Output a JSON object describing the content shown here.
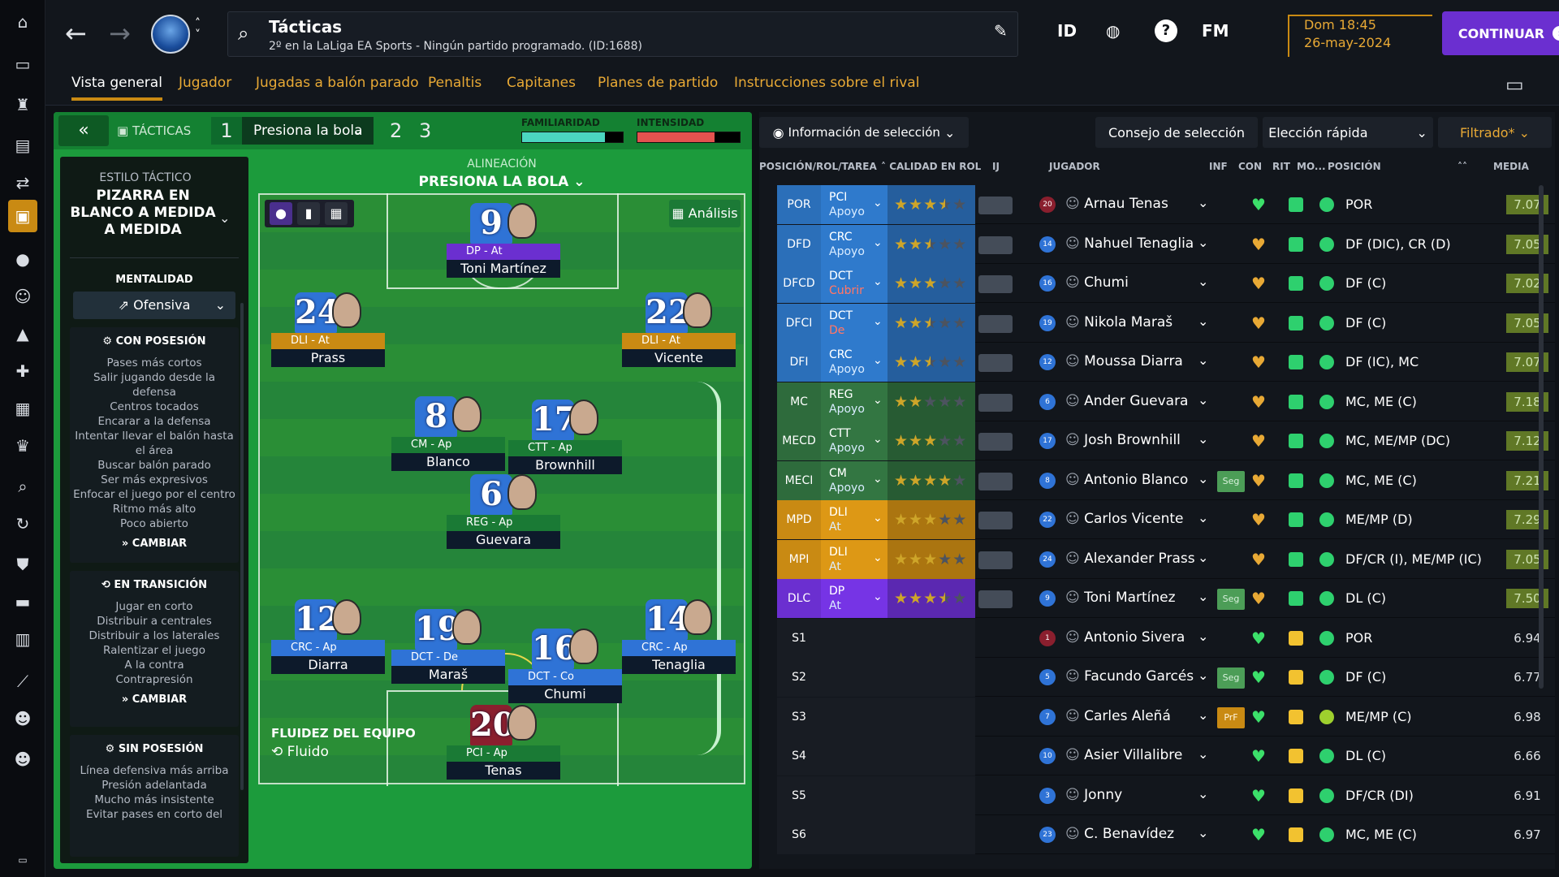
{
  "app": {
    "title": "Tácticas",
    "subtitle": "2º en la LaLiga EA Sports - Ningún partido programado. (ID:1688)"
  },
  "topbar": {
    "id_label": "ID",
    "help": "?",
    "fm": "FM",
    "date_line1": "Dom 18:45",
    "date_line2": "26-may-2024",
    "continue_label": "CONTINUAR"
  },
  "tabs": [
    "Vista general",
    "Jugador",
    "Jugadas a balón parado",
    "Penaltis",
    "Capitanes",
    "Planes de partido",
    "Instrucciones sobre el rival"
  ],
  "tactic_bar": {
    "label": "TÁCTICAS",
    "slot1": "1",
    "tactic_name": "Presiona la bola",
    "slot2": "2",
    "slot3": "3",
    "familiarity_label": "FAMILIARIDAD",
    "familiarity_value": 0.82,
    "intensity_label": "INTENSIDAD",
    "intensity_value": 0.75
  },
  "style": {
    "heading": "ESTILO TÁCTICO",
    "name": "PIZARRA EN BLANCO A MEDIDA A MEDIDA",
    "mentality_label": "MENTALIDAD",
    "mentality_value": "Ofensiva",
    "in_possession": {
      "title": "CON POSESIÓN",
      "items": [
        "Pases más cortos",
        "Salir jugando desde la defensa",
        "Centros tocados",
        "Encarar a la defensa",
        "Intentar llevar el balón hasta el área",
        "Buscar balón parado",
        "Ser más expresivos",
        "Enfocar el juego por el centro",
        "Ritmo más alto",
        "Poco abierto"
      ],
      "change": "CAMBIAR"
    },
    "transition": {
      "title": "EN TRANSICIÓN",
      "items": [
        "Jugar en corto",
        "Distribuir a centrales",
        "Distribuir a los laterales",
        "Ralentizar el juego",
        "A la contra",
        "Contrapresión"
      ],
      "change": "CAMBIAR"
    },
    "out_possession": {
      "title": "SIN POSESIÓN",
      "items": [
        "Línea defensiva más arriba",
        "Presión adelantada",
        "Mucho más insistente",
        "Evitar pases en corto del"
      ]
    }
  },
  "pitch": {
    "alignment_label": "ALINEACIÓN",
    "alignment_name": "PRESIONA LA BOLA",
    "analysis_label": "Análisis",
    "fluidity_label": "FLUIDEZ DEL EQUIPO",
    "fluidity_value": "Fluido",
    "players": [
      {
        "num": "9",
        "role": "DP - At",
        "name": "Toni Martínez",
        "kind": "st"
      },
      {
        "num": "24",
        "role": "DLI - At",
        "name": "Prass",
        "kind": "wing"
      },
      {
        "num": "22",
        "role": "DLI - At",
        "name": "Vicente",
        "kind": "wing"
      },
      {
        "num": "8",
        "role": "CM - Ap",
        "name": "Blanco",
        "kind": "mid"
      },
      {
        "num": "17",
        "role": "CTT - Ap",
        "name": "Brownhill",
        "kind": "mid"
      },
      {
        "num": "6",
        "role": "REG - Ap",
        "name": "Guevara",
        "kind": "mid"
      },
      {
        "num": "12",
        "role": "CRC - Ap",
        "name": "Diarra",
        "kind": "def"
      },
      {
        "num": "19",
        "role": "DCT - De",
        "name": "Maraš",
        "kind": "def"
      },
      {
        "num": "16",
        "role": "DCT - Co",
        "name": "Chumi",
        "kind": "def"
      },
      {
        "num": "14",
        "role": "CRC - Ap",
        "name": "Tenaglia",
        "kind": "def"
      },
      {
        "num": "20",
        "role": "PCI - Ap",
        "name": "Tenas",
        "kind": "gk"
      }
    ]
  },
  "selection": {
    "info_btn": "Información de selección",
    "advice_btn": "Consejo de selección",
    "quick_btn": "Elección rápida",
    "filter_btn": "Filtrado*",
    "columns": [
      "POSICIÓN/ROL/TAREA",
      "CALIDAD EN ROL",
      "IJ",
      "JUGADOR",
      "INF",
      "CON",
      "RIT",
      "MO...",
      "POSICIÓN",
      "MEDIA"
    ],
    "rows": [
      {
        "pos": "POR",
        "role": "PCI",
        "duty": "Apoyo",
        "stars": 3.5,
        "avatar": "20",
        "name": "Arnau Tenas",
        "inf": "",
        "con": "#3ce06a",
        "posn": "POR",
        "media": "7.07",
        "color": "#2b6fb9"
      },
      {
        "pos": "DFD",
        "role": "CRC",
        "duty": "Apoyo",
        "stars": 2.5,
        "avatar": "14",
        "name": "Nahuel Tenaglia",
        "inf": "",
        "con": "#e8a935",
        "posn": "DF (DIC), CR (D)",
        "media": "7.05",
        "color": "#2b6fb9"
      },
      {
        "pos": "DFCD",
        "role": "DCT",
        "duty": "Cubrir",
        "stars": 3,
        "avatar": "16",
        "name": "Chumi",
        "inf": "",
        "con": "#e8a935",
        "posn": "DF (C)",
        "media": "7.02",
        "color": "#2b6fb9"
      },
      {
        "pos": "DFCI",
        "role": "DCT",
        "duty": "De",
        "stars": 2.5,
        "avatar": "19",
        "name": "Nikola Maraš",
        "inf": "",
        "con": "#e8a935",
        "posn": "DF (C)",
        "media": "7.05",
        "color": "#2b6fb9"
      },
      {
        "pos": "DFI",
        "role": "CRC",
        "duty": "Apoyo",
        "stars": 2.5,
        "avatar": "12",
        "name": "Moussa Diarra",
        "inf": "",
        "con": "#e8a935",
        "posn": "DF (IC), MC",
        "media": "7.07",
        "color": "#2b6fb9"
      },
      {
        "pos": "MC",
        "role": "REG",
        "duty": "Apoyo",
        "stars": 2,
        "avatar": "6",
        "name": "Ander Guevara",
        "inf": "",
        "con": "#e8a935",
        "posn": "MC, ME (C)",
        "media": "7.18",
        "color": "#2e6b3c"
      },
      {
        "pos": "MECD",
        "role": "CTT",
        "duty": "Apoyo",
        "stars": 3,
        "avatar": "17",
        "name": "Josh Brownhill",
        "inf": "",
        "con": "#e8a935",
        "posn": "MC, ME/MP (DC)",
        "media": "7.12",
        "color": "#2e6b3c"
      },
      {
        "pos": "MECI",
        "role": "CM",
        "duty": "Apoyo",
        "stars": 4,
        "avatar": "8",
        "name": "Antonio Blanco",
        "inf": "Seg",
        "con": "#e8a935",
        "posn": "MC, ME (C)",
        "media": "7.21",
        "color": "#2e6b3c"
      },
      {
        "pos": "MPD",
        "role": "DLI",
        "duty": "At",
        "stars": 3,
        "avatar": "22",
        "name": "Carlos Vicente",
        "inf": "",
        "con": "#e8a935",
        "posn": "ME/MP (D)",
        "media": "7.29",
        "color": "#c98a13"
      },
      {
        "pos": "MPI",
        "role": "DLI",
        "duty": "At",
        "stars": 3,
        "avatar": "24",
        "name": "Alexander Prass",
        "inf": "",
        "con": "#e8a935",
        "posn": "DF/CR (I), ME/MP (IC)",
        "media": "7.05",
        "color": "#c98a13"
      },
      {
        "pos": "DLC",
        "role": "DP",
        "duty": "At",
        "stars": 3.5,
        "avatar": "9",
        "name": "Toni Martínez",
        "inf": "Seg",
        "con": "#e8a935",
        "posn": "DL (C)",
        "media": "7.50",
        "color": "#6b2fd0"
      },
      {
        "pos": "S1",
        "role": "",
        "duty": "",
        "stars": 0,
        "avatar": "1",
        "name": "Antonio Sivera",
        "inf": "",
        "con": "#3ce06a",
        "posn": "POR",
        "media": "6.94",
        "color": ""
      },
      {
        "pos": "S2",
        "role": "",
        "duty": "",
        "stars": 0,
        "avatar": "5",
        "name": "Facundo Garcés",
        "inf": "Seg",
        "con": "#3ce06a",
        "posn": "DF (C)",
        "media": "6.77",
        "color": ""
      },
      {
        "pos": "S3",
        "role": "",
        "duty": "",
        "stars": 0,
        "avatar": "7",
        "name": "Carles Aleñá",
        "inf": "PrF",
        "con": "#3ce06a",
        "posn": "ME/MP (C)",
        "media": "6.98",
        "color": ""
      },
      {
        "pos": "S4",
        "role": "",
        "duty": "",
        "stars": 0,
        "avatar": "10",
        "name": "Asier Villalibre",
        "inf": "",
        "con": "#3ce06a",
        "posn": "DL (C)",
        "media": "6.66",
        "color": ""
      },
      {
        "pos": "S5",
        "role": "",
        "duty": "",
        "stars": 0,
        "avatar": "3",
        "name": "Jonny",
        "inf": "",
        "con": "#3ce06a",
        "posn": "DF/CR (DI)",
        "media": "6.91",
        "color": ""
      },
      {
        "pos": "S6",
        "role": "",
        "duty": "",
        "stars": 0,
        "avatar": "23",
        "name": "C. Benavídez",
        "inf": "",
        "con": "#3ce06a",
        "posn": "MC, ME (C)",
        "media": "6.97",
        "color": ""
      }
    ]
  }
}
